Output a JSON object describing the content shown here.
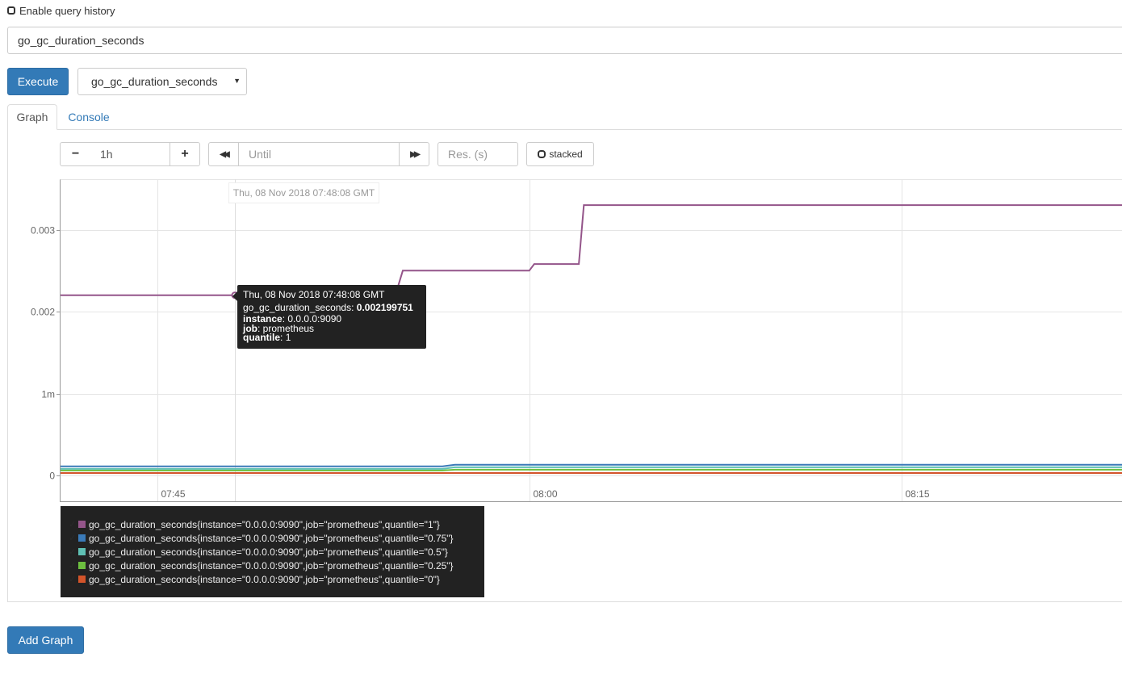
{
  "history": {
    "label": "Enable query history"
  },
  "query": {
    "value": "go_gc_duration_seconds"
  },
  "execute": {
    "label": "Execute"
  },
  "metric_select": {
    "value": "go_gc_duration_seconds"
  },
  "tabs": {
    "graph": "Graph",
    "console": "Console"
  },
  "controls": {
    "minus": "−",
    "range": "1h",
    "plus": "+",
    "back": "◀◀",
    "until_placeholder": "Until",
    "forward": "▶▶",
    "res_placeholder": "Res. (s)",
    "stacked": "stacked"
  },
  "hover_time": "Thu, 08 Nov 2018 07:48:08 GMT",
  "tooltip": {
    "time": "Thu, 08 Nov 2018 07:48:08 GMT",
    "metric": "go_gc_duration_seconds",
    "value": "0.002199751",
    "instance_label": "instance",
    "instance": "0.0.0.0:9090",
    "job_label": "job",
    "job": "prometheus",
    "quantile_label": "quantile",
    "quantile": "1"
  },
  "chart_data": {
    "type": "line",
    "y_ticks": [
      {
        "value": 0,
        "label": "0"
      },
      {
        "value": 0.001,
        "label": "1m"
      },
      {
        "value": 0.002,
        "label": "0.002"
      },
      {
        "value": 0.003,
        "label": "0.003"
      }
    ],
    "x_ticks": [
      {
        "minutes": 45,
        "label": "07:45"
      },
      {
        "minutes": 60,
        "label": "08:00"
      },
      {
        "minutes": 75,
        "label": "08:15"
      }
    ],
    "x_range_minutes": [
      41.1,
      83.9
    ],
    "ylim": [
      0,
      0.0036
    ],
    "hover_minutes": 48.13,
    "series": [
      {
        "name": "go_gc_duration_seconds{instance=\"0.0.0.0:9090\",job=\"prometheus\",quantile=\"1\"}",
        "color": "#94558a",
        "points": [
          [
            41.1,
            0.0022
          ],
          [
            48.13,
            0.0022
          ],
          [
            47.9,
            0.0022
          ],
          [
            54.6,
            0.0022
          ],
          [
            54.9,
            0.0025
          ],
          [
            60.0,
            0.0025
          ],
          [
            60.2,
            0.00258
          ],
          [
            62.0,
            0.00258
          ],
          [
            62.2,
            0.0033
          ],
          [
            83.9,
            0.0033
          ]
        ]
      },
      {
        "name": "go_gc_duration_seconds{instance=\"0.0.0.0:9090\",job=\"prometheus\",quantile=\"0.75\"}",
        "color": "#3a7ab8",
        "points": [
          [
            41.1,
            0.00011
          ],
          [
            56.5,
            0.00011
          ],
          [
            57.0,
            0.00013
          ],
          [
            83.9,
            0.00013
          ]
        ]
      },
      {
        "name": "go_gc_duration_seconds{instance=\"0.0.0.0:9090\",job=\"prometheus\",quantile=\"0.5\"}",
        "color": "#5fc0b4",
        "points": [
          [
            41.1,
            8e-05
          ],
          [
            56.5,
            8e-05
          ],
          [
            57.0,
            0.0001
          ],
          [
            83.9,
            0.0001
          ]
        ]
      },
      {
        "name": "go_gc_duration_seconds{instance=\"0.0.0.0:9090\",job=\"prometheus\",quantile=\"0.25\"}",
        "color": "#6cbf3f",
        "points": [
          [
            41.1,
            6e-05
          ],
          [
            56.5,
            6e-05
          ],
          [
            57.0,
            7e-05
          ],
          [
            83.9,
            7e-05
          ]
        ]
      },
      {
        "name": "go_gc_duration_seconds{instance=\"0.0.0.0:9090\",job=\"prometheus\",quantile=\"0\"}",
        "color": "#d3542a",
        "points": [
          [
            41.1,
            3e-05
          ],
          [
            83.9,
            3e-05
          ]
        ]
      }
    ]
  }
}
